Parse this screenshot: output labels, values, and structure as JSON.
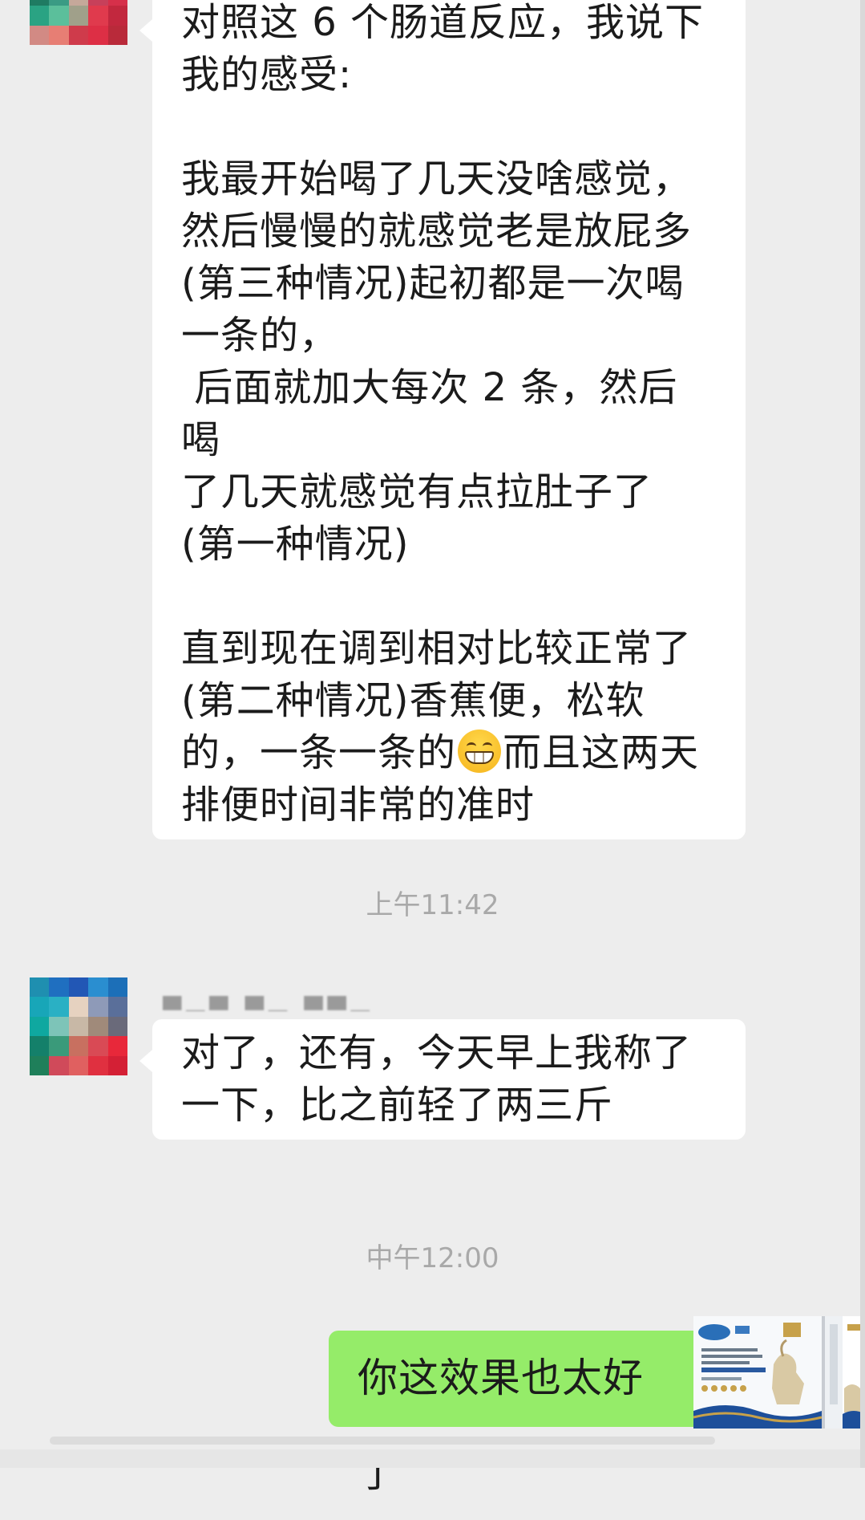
{
  "messages": [
    {
      "text_a": "对照这 6 个肠道反应，我说下\n我的感受:\n\n我最开始喝了几天没啥感觉，\n然后慢慢的就感觉老是放屁多\n(第三种情况)起初都是一次喝\n一条的，\n 后面就加大每次 2 条，然后喝\n了几天就感觉有点拉肚子了\n(第一种情况)\n\n直到现在调到相对比较正常了\n(第二种情况)香蕉便，松软\n的，一条一条的",
      "emoji": "grinning-face",
      "text_b": "而且这两天\n排便时间非常的准时"
    },
    {
      "text": "对了，还有，今天早上我称了\n一下，比之前轻了两三斤"
    },
    {
      "text": "你这效果也太好了"
    }
  ],
  "timestamps": [
    "上午11:42",
    "中午12:00"
  ],
  "colors": {
    "chat_background": "#ededed",
    "incoming_bubble": "#ffffff",
    "outgoing_bubble": "#95ec69",
    "timestamp_text": "#a9a9a9"
  }
}
